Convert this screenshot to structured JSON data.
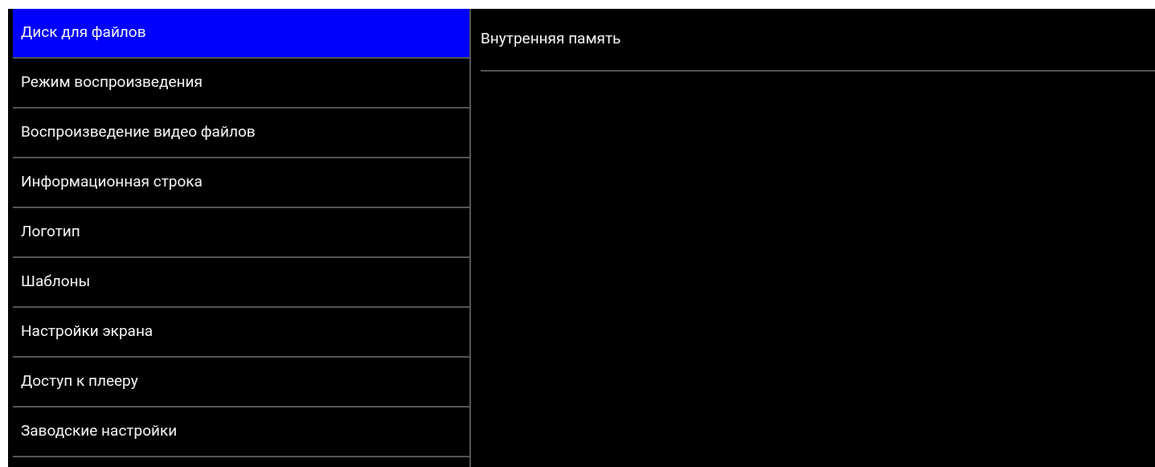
{
  "menu": [
    {
      "label": "Диск для файлов",
      "selected": true
    },
    {
      "label": "Режим воспроизведения",
      "selected": false
    },
    {
      "label": "Воспроизведение видео файлов",
      "selected": false
    },
    {
      "label": "Информационная строка",
      "selected": false
    },
    {
      "label": "Логотип",
      "selected": false
    },
    {
      "label": "Шаблоны",
      "selected": false
    },
    {
      "label": "Настройки экрана",
      "selected": false
    },
    {
      "label": "Доступ к плееру",
      "selected": false
    },
    {
      "label": "Заводские настройки",
      "selected": false
    }
  ],
  "detail": {
    "options": [
      "Внутренняя память"
    ]
  }
}
